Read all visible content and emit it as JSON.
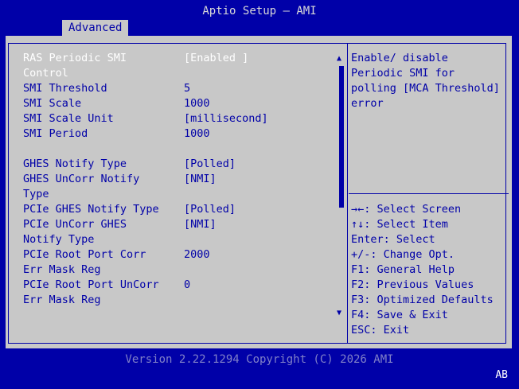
{
  "app": {
    "title": "Aptio Setup – AMI",
    "tab": "Advanced"
  },
  "settings": [
    {
      "label": "RAS Periodic SMI",
      "value": "[Enabled ]"
    },
    {
      "label": "Control",
      "value": ""
    },
    {
      "label": "SMI Threshold",
      "value": "5"
    },
    {
      "label": "SMI Scale",
      "value": "1000"
    },
    {
      "label": "SMI Scale Unit",
      "value": "[millisecond]"
    },
    {
      "label": "SMI Period",
      "value": "1000"
    },
    {
      "label": "",
      "value": ""
    },
    {
      "label": "GHES Notify Type",
      "value": "[Polled]"
    },
    {
      "label": "GHES UnCorr Notify",
      "value": "[NMI]"
    },
    {
      "label": "Type",
      "value": ""
    },
    {
      "label": "PCIe GHES Notify Type",
      "value": "[Polled]"
    },
    {
      "label": "PCIe UnCorr GHES",
      "value": "[NMI]"
    },
    {
      "label": "Notify Type",
      "value": ""
    },
    {
      "label": "PCIe Root Port Corr",
      "value": "2000"
    },
    {
      "label": "Err Mask Reg",
      "value": ""
    },
    {
      "label": "PCIe Root Port UnCorr",
      "value": "0"
    },
    {
      "label": "Err Mask Reg",
      "value": ""
    }
  ],
  "help": [
    "Enable/ disable",
    "Periodic SMI for",
    "polling [MCA Threshold]",
    "error"
  ],
  "keys": [
    "→←: Select Screen",
    "↑↓: Select Item",
    "Enter: Select",
    "+/-: Change Opt.",
    "F1: General Help",
    "F2: Previous Values",
    "F3: Optimized Defaults",
    "F4: Save & Exit",
    "ESC: Exit"
  ],
  "footer": {
    "version": "Version 2.22.1294 Copyright (C) 2026 AMI",
    "badge": "AB"
  },
  "colors": {
    "background": "#0000a8",
    "panel": "#c8c8c8",
    "selected": "#ffffff"
  },
  "icons": {
    "scroll_up": "triangle-up",
    "scroll_down": "triangle-down"
  }
}
